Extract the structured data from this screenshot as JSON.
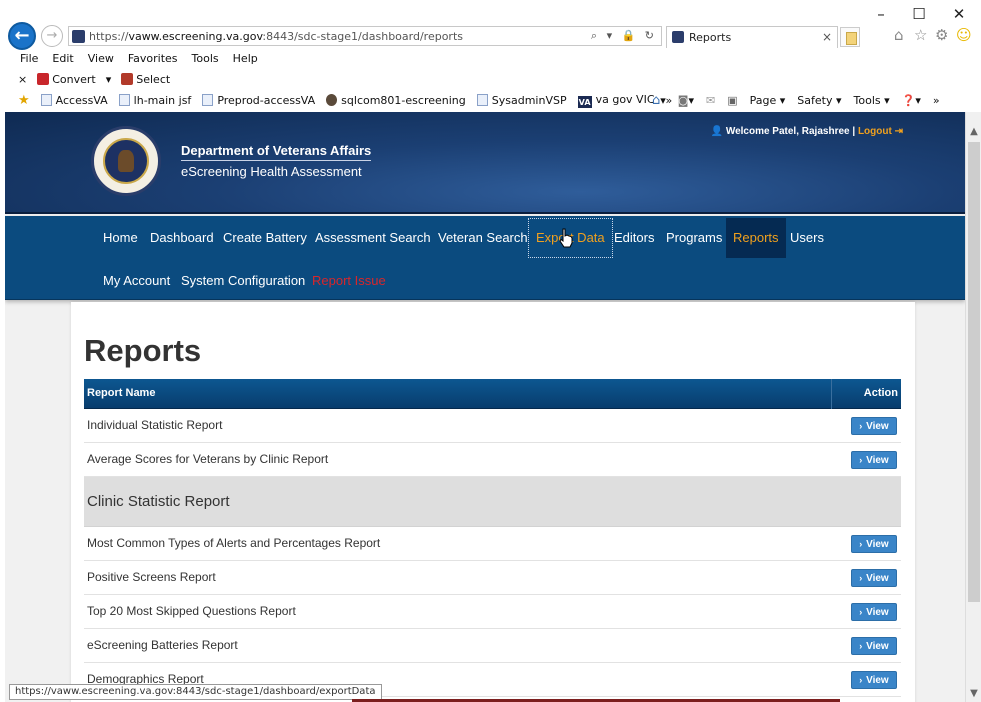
{
  "browser": {
    "window_controls": {
      "minimize": "–",
      "maximize": "☐",
      "close": "✕"
    },
    "address_url_prefix": "https://",
    "address_url_host": "vaww.escreening.va.gov",
    "address_url_rest": ":8443/sdc-stage1/dashboard/reports",
    "address_icons": "⌕ ▾ 🔒 ↻",
    "tab_title": "Reports",
    "tab_close": "×",
    "menu": [
      "File",
      "Edit",
      "View",
      "Favorites",
      "Tools",
      "Help"
    ],
    "cmdbar": {
      "close": "×",
      "convert": "Convert",
      "convert_arrow": "▾",
      "select": "Select"
    },
    "favorites": [
      "AccessVA",
      "lh-main jsf",
      "Preprod-accessVA",
      "sqlcom801-escreening",
      "SysadminVSP",
      "va gov VIC"
    ],
    "favorites_more": "»",
    "tools": [
      "▾",
      "▾",
      "Page ▾",
      "Safety ▾",
      "Tools ▾",
      "▾"
    ],
    "tools_more": "»",
    "status_url": "https://vaww.escreening.va.gov:8443/sdc-stage1/dashboard/exportData",
    "scroll_up": "▲",
    "scroll_down": "▼"
  },
  "site": {
    "org_name": "Department of Veterans Affairs",
    "app_name": "eScreening Health Assessment",
    "welcome": "Welcome Patel, Rajashree",
    "separator": "|",
    "logout": "Logout"
  },
  "nav": {
    "items": [
      "Home",
      "Dashboard",
      "Create Battery",
      "Assessment Search",
      "Veteran Search",
      "Export Data",
      "Editors",
      "Programs",
      "Reports",
      "Users",
      "My Account",
      "System Configuration",
      "Report Issue"
    ],
    "active": "Reports",
    "hovered": "Export Data"
  },
  "page": {
    "title": "Reports",
    "table_headers": {
      "name": "Report Name",
      "action": "Action"
    },
    "view_label": "View",
    "view_chevron": "›",
    "rows": [
      {
        "type": "report",
        "name": "Individual Statistic Report"
      },
      {
        "type": "report",
        "name": "Average Scores for Veterans by Clinic Report"
      },
      {
        "type": "group",
        "name": "Clinic Statistic Report"
      },
      {
        "type": "report",
        "name": "Most Common Types of Alerts and Percentages Report"
      },
      {
        "type": "report",
        "name": "Positive Screens Report"
      },
      {
        "type": "report",
        "name": "Top 20 Most Skipped Questions Report"
      },
      {
        "type": "report",
        "name": "eScreening Batteries Report"
      },
      {
        "type": "report",
        "name": "Demographics Report"
      }
    ]
  },
  "colors": {
    "header_dark": "#0f2a52",
    "nav_blue": "#0b4b7f",
    "nav_active_bg": "#052a52",
    "accent_orange": "#f0a01e",
    "issue_red": "#d8262a",
    "view_button": "#3a85c8"
  }
}
